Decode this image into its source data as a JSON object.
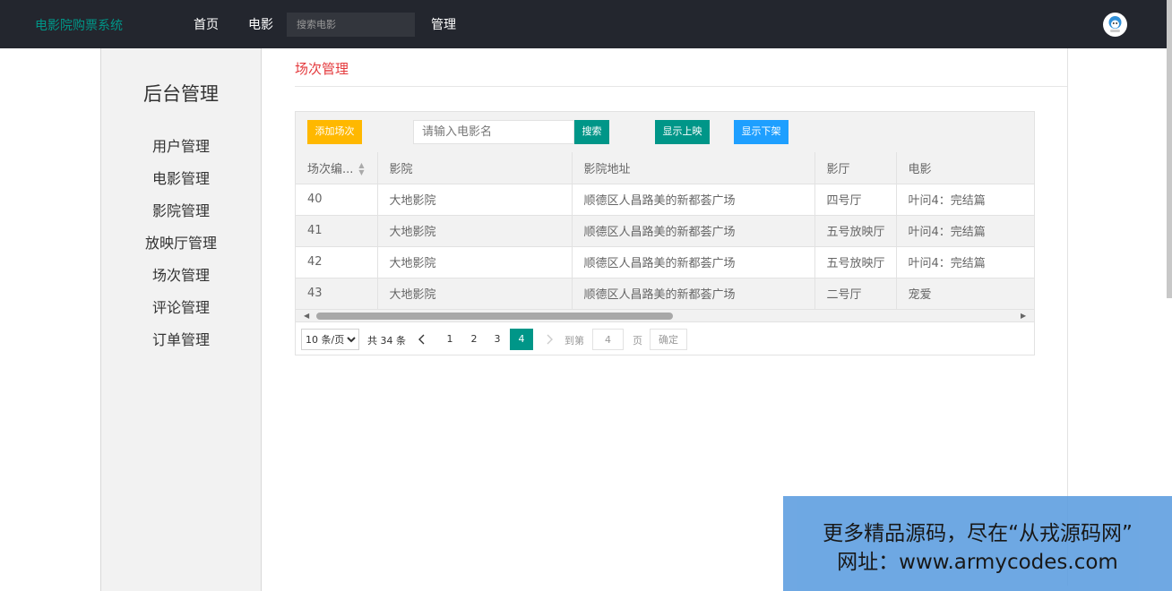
{
  "nav": {
    "brand": "电影院购票系统",
    "links": [
      "首页",
      "电影"
    ],
    "search_placeholder": "搜索电影",
    "admin_link": "管理"
  },
  "sidebar": {
    "title": "后台管理",
    "items": [
      "用户管理",
      "电影管理",
      "影院管理",
      "放映厅管理",
      "场次管理",
      "评论管理",
      "订单管理"
    ]
  },
  "page": {
    "title": "场次管理"
  },
  "toolbar": {
    "add_label": "添加场次",
    "search_placeholder": "请输入电影名",
    "search_label": "搜索",
    "show_on_label": "显示上映",
    "show_off_label": "显示下架"
  },
  "table": {
    "columns": [
      "场次编...",
      "影院",
      "影院地址",
      "影厅",
      "电影"
    ],
    "rows": [
      [
        "40",
        "大地影院",
        "顺德区人昌路美的新都荟广场",
        "四号厅",
        "叶问4：完结篇"
      ],
      [
        "41",
        "大地影院",
        "顺德区人昌路美的新都荟广场",
        "五号放映厅",
        "叶问4：完结篇"
      ],
      [
        "42",
        "大地影院",
        "顺德区人昌路美的新都荟广场",
        "五号放映厅",
        "叶问4：完结篇"
      ],
      [
        "43",
        "大地影院",
        "顺德区人昌路美的新都荟广场",
        "二号厅",
        "宠爱"
      ]
    ]
  },
  "pager": {
    "page_size": "10 条/页",
    "total": "共 34 条",
    "pages": [
      "1",
      "2",
      "3",
      "4"
    ],
    "current": "4",
    "goto_prefix": "到第",
    "goto_value": "4",
    "goto_suffix": "页",
    "confirm_label": "确定"
  },
  "watermark": {
    "line1": "更多精品源码，尽在“从戎源码网”",
    "line2": "网址：www.armycodes.com"
  },
  "colors": {
    "brand": "#009688",
    "accent_red": "#e4393c",
    "warn": "#ffb800",
    "blue": "#1e9fff"
  }
}
